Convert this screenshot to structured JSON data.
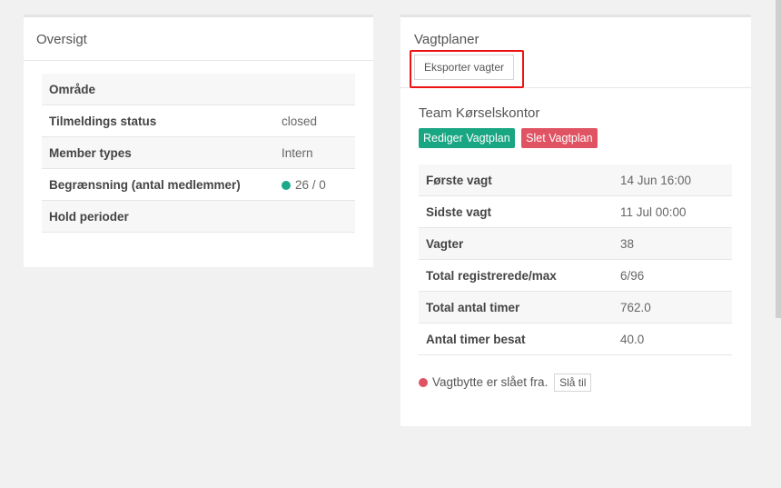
{
  "overview": {
    "title": "Oversigt",
    "rows": [
      {
        "key": "Område",
        "value": ""
      },
      {
        "key": "Tilmeldings status",
        "value": "closed"
      },
      {
        "key": "Member types",
        "value": "Intern"
      },
      {
        "key": "Begrænsning (antal medlemmer)",
        "value": "26 / 0"
      },
      {
        "key": "Hold perioder",
        "value": ""
      }
    ]
  },
  "shifts": {
    "title": "Vagtplaner",
    "export_label": "Eksporter vagter",
    "team_name": "Team Kørselskontor",
    "edit_label": "Rediger Vagtplan",
    "delete_label": "Slet Vagtplan",
    "rows": [
      {
        "key": "Første vagt",
        "value": "14 Jun 16:00"
      },
      {
        "key": "Sidste vagt",
        "value": "11 Jul 00:00"
      },
      {
        "key": "Vagter",
        "value": "38"
      },
      {
        "key": "Total registrerede/max",
        "value": "6/96"
      },
      {
        "key": "Total antal timer",
        "value": "762.0"
      },
      {
        "key": "Antal timer besat",
        "value": "40.0"
      }
    ],
    "swap_text": "Vagtbytte er slået fra.",
    "swap_button": "Slå til"
  },
  "colors": {
    "green": "#19a683",
    "red": "#e05363",
    "highlight": "#ee1111"
  },
  "icons": {
    "status_dot_green": "green-dot-icon",
    "status_dot_red": "red-dot-icon"
  }
}
